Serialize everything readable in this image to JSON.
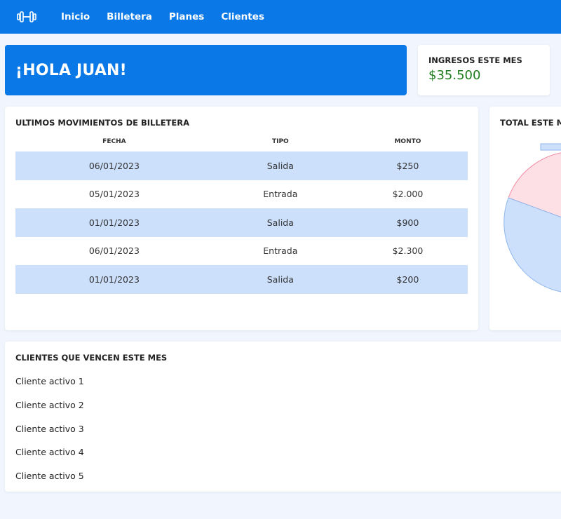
{
  "nav": {
    "logo_icon": "dumbbell-icon",
    "links": [
      "Inicio",
      "Billetera",
      "Planes",
      "Clientes"
    ]
  },
  "greeting": "¡HOLA JUAN!",
  "income": {
    "label": "INGRESOS ESTE MES",
    "value": "$35.500"
  },
  "movements": {
    "title": "ULTIMOS MOVIMIENTOS DE BILLETERA",
    "columns": [
      "FECHA",
      "TIPO",
      "MONTO"
    ],
    "rows": [
      [
        "06/01/2023",
        "Salida",
        "$250"
      ],
      [
        "05/01/2023",
        "Entrada",
        "$2.000"
      ],
      [
        "01/01/2023",
        "Salida",
        "$900"
      ],
      [
        "06/01/2023",
        "Entrada",
        "$2.300"
      ],
      [
        "01/01/2023",
        "Salida",
        "$200"
      ]
    ]
  },
  "pie": {
    "title": "TOTAL ESTE MES",
    "colors": {
      "pink_fill": "#fde0e6",
      "pink_stroke": "#f58aa2",
      "blue_fill": "#cce0fc",
      "blue_stroke": "#8fb6ec"
    }
  },
  "clients": {
    "title": "CLIENTES QUE VENCEN ESTE MES",
    "items": [
      "Cliente activo 1",
      "Cliente activo 2",
      "Cliente activo 3",
      "Cliente activo 4",
      "Cliente activo 5"
    ]
  }
}
